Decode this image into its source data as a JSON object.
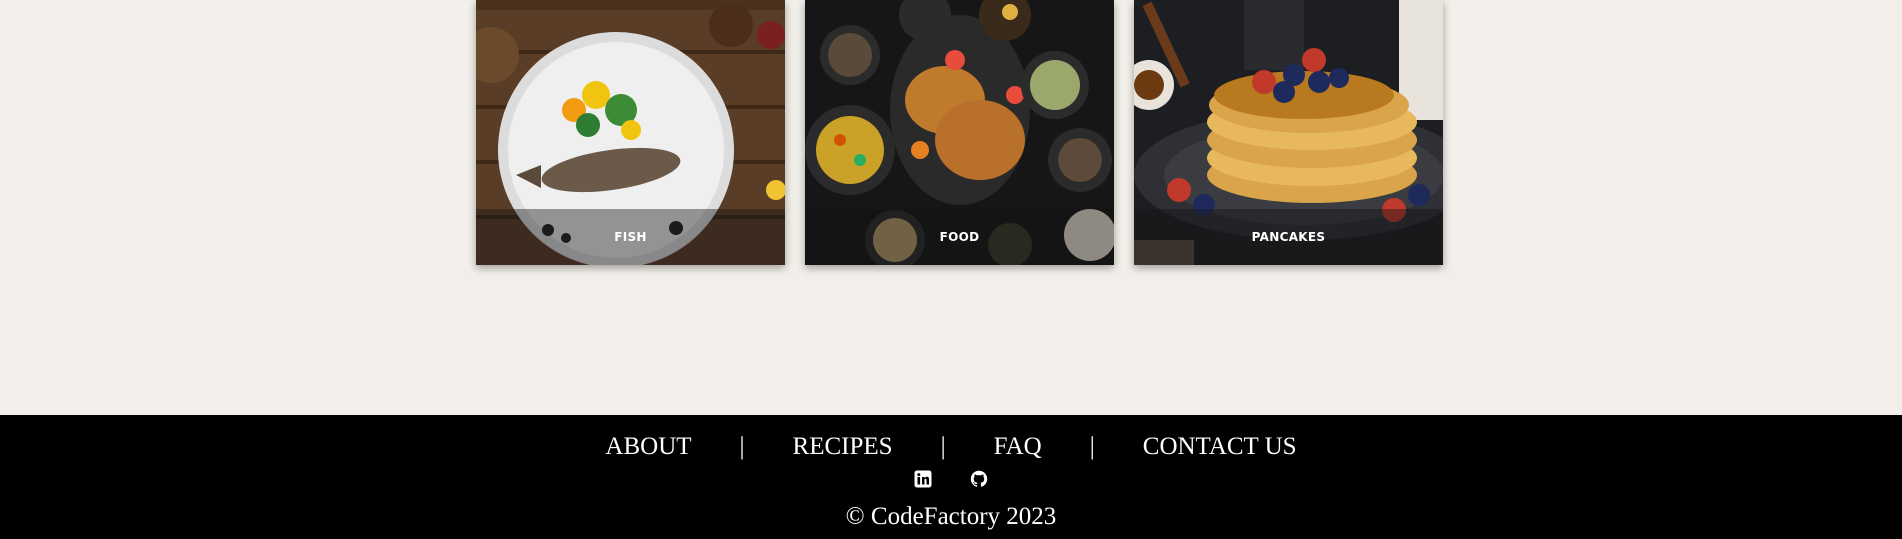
{
  "cards": [
    {
      "label": "FISH",
      "icon": "fish-dish-photo"
    },
    {
      "label": "FOOD",
      "icon": "food-platter-photo"
    },
    {
      "label": "PANCAKES",
      "icon": "pancake-stack-photo"
    }
  ],
  "footer": {
    "nav": [
      {
        "label": "ABOUT"
      },
      {
        "label": "RECIPES"
      },
      {
        "label": "FAQ"
      },
      {
        "label": "CONTACT US"
      }
    ],
    "separator": "|",
    "social": [
      {
        "icon": "linkedin-icon"
      },
      {
        "icon": "github-icon"
      }
    ],
    "copyright": "© CodeFactory 2023"
  },
  "colors": {
    "page_background": "#f2efea",
    "footer_background": "#000000",
    "footer_text": "#ffffff"
  }
}
